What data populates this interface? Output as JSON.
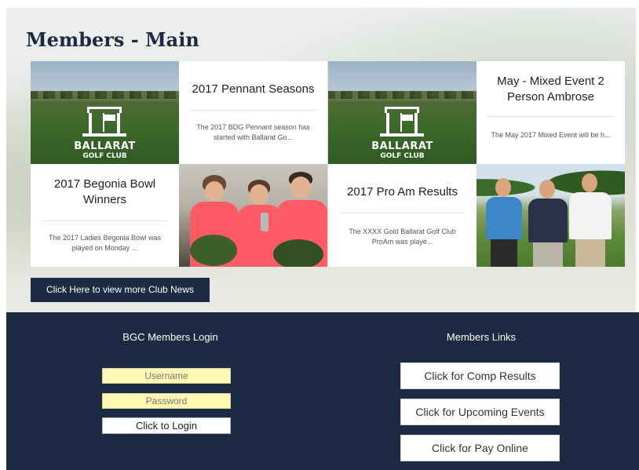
{
  "page": {
    "title": "Members - Main"
  },
  "news": [
    {
      "title": "2017 Pennant Seasons",
      "excerpt": "The 2017 BDG Pennant season has started with Ballarat Go..."
    },
    {
      "title": "May - Mixed Event 2 Person Ambrose",
      "excerpt": "The May 2017 Mixed Event will be h..."
    },
    {
      "title": "2017 Begonia Bowl Winners",
      "excerpt": "The 2017 Ladies Begonia Bowl was played on Monday ..."
    },
    {
      "title": "2017 Pro Am Results",
      "excerpt": "The XXXX Gold Ballarat Golf Club ProAm was playe..."
    }
  ],
  "logo": {
    "line1": "BALLARAT",
    "line2": "GOLF CLUB"
  },
  "more_news_label": "Click Here to view more Club News",
  "login": {
    "heading": "BGC Members Login",
    "username_placeholder": "Username",
    "password_placeholder": "Password",
    "button_label": "Click to Login"
  },
  "links": {
    "heading": "Members Links",
    "items": [
      {
        "label": "Click for Comp Results"
      },
      {
        "label": "Click for Upcoming Events"
      },
      {
        "label": "Click for Pay Online"
      }
    ]
  },
  "colors": {
    "navy": "#1c2a44",
    "field_yellow": "#fff8b3",
    "shirt_pink": "#ff5b67"
  }
}
